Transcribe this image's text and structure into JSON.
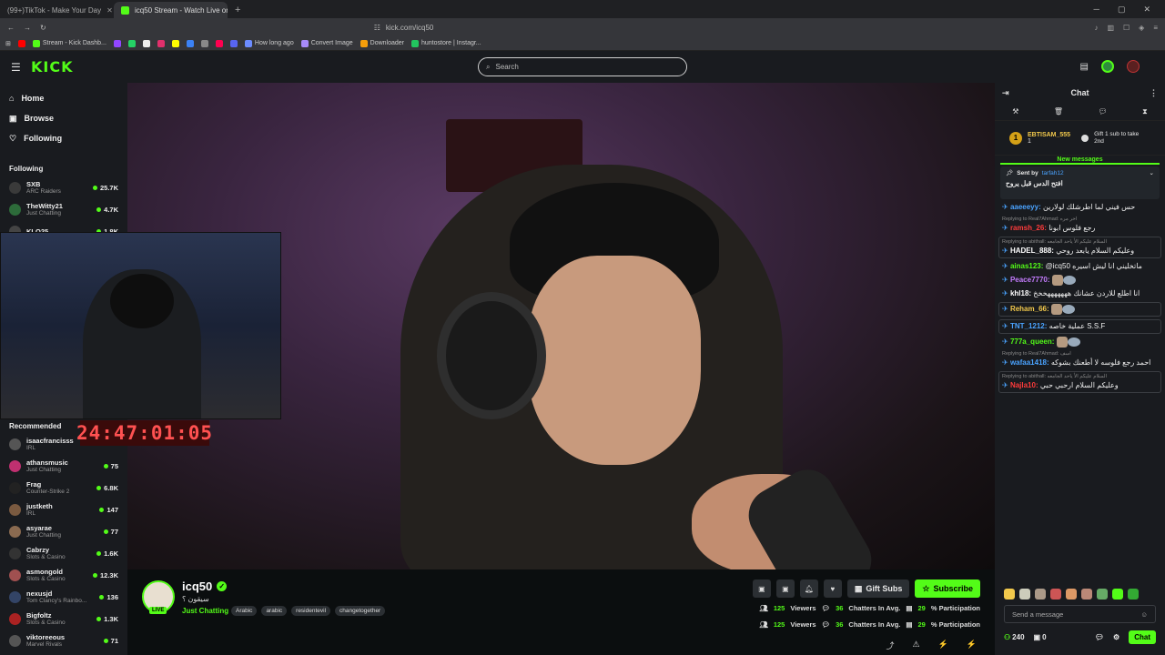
{
  "browser": {
    "tabs": [
      {
        "title": "(99+)TikTok - Make Your Day"
      },
      {
        "title": "icq50 Stream - Watch Live on Kick"
      }
    ],
    "url": "kick.com/icq50",
    "bookmarks": [
      "Stream - Kick Dashb...",
      "How long ago",
      "Convert Image",
      "Downloader",
      "huntostore | Instagr..."
    ]
  },
  "kick": {
    "logo": "KICK",
    "search_placeholder": "Search"
  },
  "sidebar": {
    "nav": [
      {
        "label": "Home",
        "icon": "home-icon"
      },
      {
        "label": "Browse",
        "icon": "browse-icon"
      },
      {
        "label": "Following",
        "icon": "heart-icon"
      }
    ],
    "following_title": "Following",
    "following": [
      {
        "name": "SXB",
        "category": "ARC Raiders",
        "viewers": "25.7K",
        "color": "#3a3a3a"
      },
      {
        "name": "TheWitty21",
        "category": "Just Chatting",
        "viewers": "4.7K",
        "color": "#2d6b3a"
      },
      {
        "name": "KLO25",
        "category": "",
        "viewers": "1.8K",
        "color": "#444"
      }
    ],
    "recommended_title": "Recommended",
    "recommended": [
      {
        "name": "isaacfrancisss",
        "category": "IRL",
        "viewers": "",
        "color": "#555"
      },
      {
        "name": "athansmusic",
        "category": "Just Chatting",
        "viewers": "75",
        "color": "#c03070"
      },
      {
        "name": "Frag",
        "category": "Counter-Strike 2",
        "viewers": "6.8K",
        "color": "#222"
      },
      {
        "name": "justketh",
        "category": "IRL",
        "viewers": "147",
        "color": "#7a5a40"
      },
      {
        "name": "asyarae",
        "category": "Just Chatting",
        "viewers": "77",
        "color": "#8a6a50"
      },
      {
        "name": "Cabrzy",
        "category": "Slots & Casino",
        "viewers": "1.6K",
        "color": "#333"
      },
      {
        "name": "asmongold",
        "category": "Slots & Casino",
        "viewers": "12.3K",
        "color": "#a05050"
      },
      {
        "name": "nexusjd",
        "category": "Tom Clancy's Rainbo...",
        "viewers": "136",
        "color": "#334466"
      },
      {
        "name": "Bigfoltz",
        "category": "Slots & Casino",
        "viewers": "1.3K",
        "color": "#aa2222"
      },
      {
        "name": "viktoreeous",
        "category": "Marvel Rivals",
        "viewers": "71",
        "color": "#555"
      }
    ]
  },
  "player": {
    "timer": "24:47:01:05"
  },
  "stream": {
    "name": "icq50",
    "title": "سيقون ؟",
    "category": "Just Chatting",
    "live": "LIVE",
    "tags": [
      "Arabic",
      "arabic",
      "residentevil",
      "changetogether"
    ],
    "gift_label": "Gift Subs",
    "subscribe_label": "Subscribe",
    "stats": [
      {
        "viewers": "125",
        "viewers_label": "Viewers",
        "chatters": "36",
        "chatters_label": "Chatters In Avg.",
        "participation": "29",
        "participation_label": "% Participation"
      },
      {
        "viewers": "125",
        "viewers_label": "Viewers",
        "chatters": "36",
        "chatters_label": "Chatters In Avg.",
        "participation": "29",
        "participation_label": "% Participation"
      }
    ]
  },
  "chat": {
    "title": "Chat",
    "pinned": {
      "rank": "1",
      "user": "EBTISAM_555",
      "count": "1",
      "text": "Gift 1 sub to take 2nd"
    },
    "new_messages": "New messages",
    "sent_by": {
      "label": "Sent by",
      "user": "tarfah12",
      "text": "افتح الدس قبل يروح"
    },
    "messages": [
      {
        "reply": "",
        "user": "aaeeeyy:",
        "color": "#4aa3ff",
        "text": "حس فيني لما اطرشلك لولارين",
        "boxed": false
      },
      {
        "reply": "Replying to Real7Ahmad: اخر مره",
        "user": "ramsh_26:",
        "color": "#ff3b3b",
        "text": "رجع فلوس ابونا",
        "boxed": false
      },
      {
        "reply": "Replying to abithall: السلام عليكم الأ ياحد الجامعه",
        "user": "HADEL_888:",
        "color": "#ffffff",
        "text": "وعليكم السلام يابعد روحي",
        "boxed": true
      },
      {
        "reply": "",
        "user": "ainas123:",
        "color": "#53fc18",
        "text": "@icq50 ماتخليني انا ليش اسيره",
        "boxed": false
      },
      {
        "reply": "",
        "user": "Peace7770:",
        "color": "#c57cff",
        "text": "",
        "boxed": false
      },
      {
        "reply": "",
        "user": "khl18:",
        "color": "#ffffff",
        "text": "انا اطلع للاردن عشانك هههههههخخخ",
        "boxed": false
      },
      {
        "reply": "",
        "user": "Reham_66:",
        "color": "#f2c94c",
        "text": "",
        "boxed": true
      },
      {
        "reply": "",
        "user": "TNT_1212:",
        "color": "#4aa3ff",
        "text": "عملية خاصه S.S.F",
        "boxed": true
      },
      {
        "reply": "",
        "user": "777a_queen:",
        "color": "#53fc18",
        "text": "",
        "boxed": false
      },
      {
        "reply": "Replying to Real7Ahmad: اسف",
        "user": "wafaa1418:",
        "color": "#4aa3ff",
        "text": "احمد رجع فلوسه لا أطعنك بشوكه",
        "boxed": false
      },
      {
        "reply": "Replying to abithall: السلام عليكم الأ ياحد الجامعه",
        "user": "Najla10:",
        "color": "#ff3b3b",
        "text": "وعليكم السلام ارحبي حبي",
        "boxed": true
      }
    ],
    "input_placeholder": "Send a message",
    "points": "240",
    "count2": "0",
    "chat_button": "Chat"
  }
}
